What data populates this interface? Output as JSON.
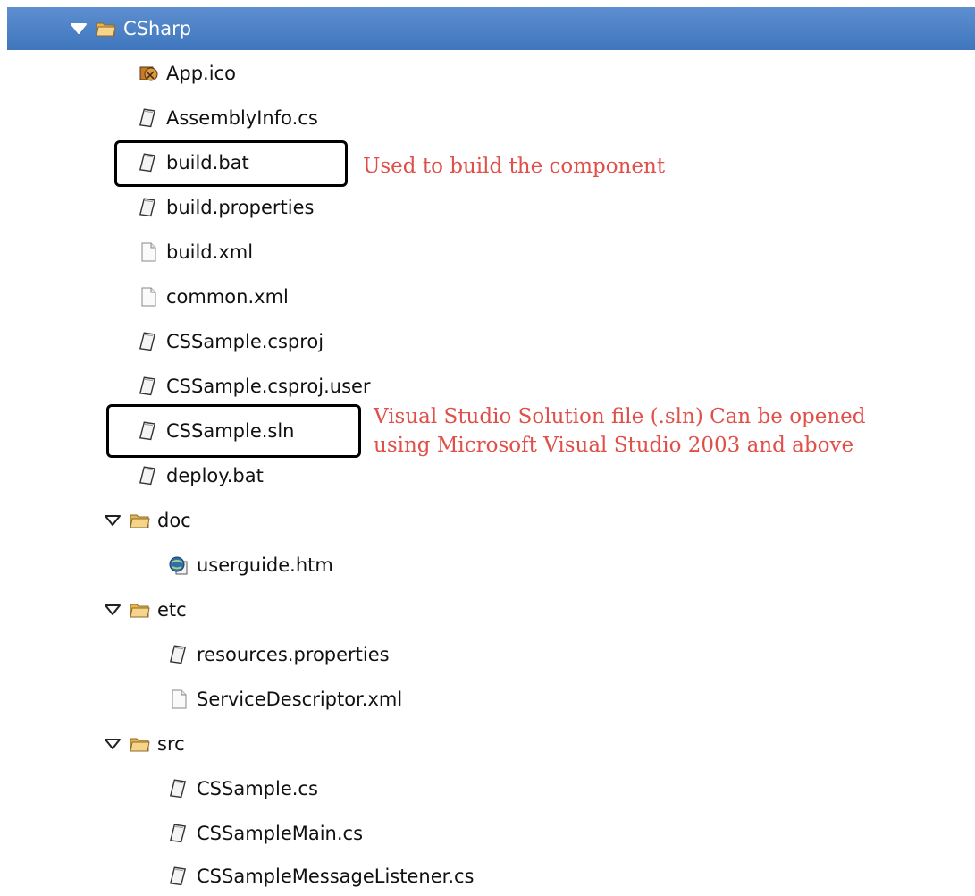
{
  "tree": {
    "root": {
      "label": "CSharp",
      "expanded": true
    },
    "items": [
      {
        "label": "App.ico",
        "icon": "app-ico-icon"
      },
      {
        "label": "AssemblyInfo.cs",
        "icon": "text-file-icon"
      },
      {
        "label": "build.bat",
        "icon": "text-file-icon"
      },
      {
        "label": "build.properties",
        "icon": "text-file-icon"
      },
      {
        "label": "build.xml",
        "icon": "blank-file-icon"
      },
      {
        "label": "common.xml",
        "icon": "blank-file-icon"
      },
      {
        "label": "CSSample.csproj",
        "icon": "text-file-icon"
      },
      {
        "label": "CSSample.csproj.user",
        "icon": "text-file-icon"
      },
      {
        "label": "CSSample.sln",
        "icon": "text-file-icon"
      },
      {
        "label": "deploy.bat",
        "icon": "text-file-icon"
      },
      {
        "label": "doc",
        "icon": "folder-icon",
        "expanded": true
      },
      {
        "label": "userguide.htm",
        "icon": "html-file-icon"
      },
      {
        "label": "etc",
        "icon": "folder-icon",
        "expanded": true
      },
      {
        "label": "resources.properties",
        "icon": "text-file-icon"
      },
      {
        "label": "ServiceDescriptor.xml",
        "icon": "blank-file-icon"
      },
      {
        "label": "src",
        "icon": "folder-icon",
        "expanded": true
      },
      {
        "label": "CSSample.cs",
        "icon": "text-file-icon"
      },
      {
        "label": "CSSampleMain.cs",
        "icon": "text-file-icon"
      },
      {
        "label": "CSSampleMessageListener.cs",
        "icon": "text-file-icon"
      }
    ]
  },
  "annotations": {
    "build_bat": "Used to build the component",
    "sln_line1": "Visual Studio Solution file (.sln) Can be opened",
    "sln_line2": "using Microsoft Visual Studio 2003 and above"
  },
  "colors": {
    "selection": "#4a80c4",
    "annotation_text": "#e0504a",
    "folder": "#f2c46a"
  }
}
